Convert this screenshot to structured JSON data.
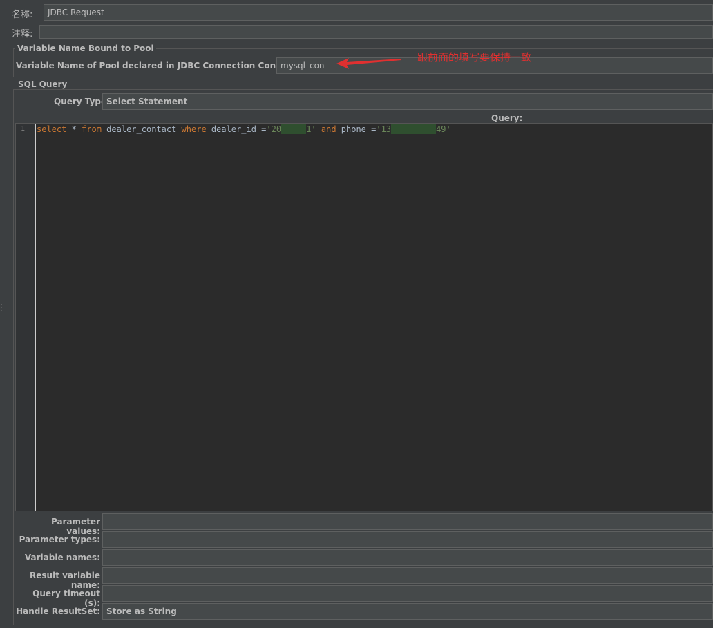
{
  "name_field": {
    "label": "名称:",
    "value": "JDBC Request"
  },
  "comment_field": {
    "label": "注释:",
    "value": ""
  },
  "pool_group": {
    "title": "Variable Name Bound to Pool",
    "pool_label": "Variable Name of Pool declared in JDBC Connection Configuration:",
    "pool_value": "mysql_con"
  },
  "annotation": {
    "text": "跟前面的填写要保持一致",
    "color": "#e03030"
  },
  "sql_group": {
    "title": "SQL Query",
    "query_type_label": "Query Type:",
    "query_type_value": "Select Statement",
    "query_label": "Query:",
    "line_number": "1",
    "code": {
      "t1": "select",
      "t2": " * ",
      "t3": "from",
      "t4": " dealer_contact ",
      "t5": "where",
      "t6": " dealer_id =",
      "t7": "'20",
      "t8": "     ",
      "t9": "1'",
      "t10": " ",
      "t11": "and",
      "t12": " phone =",
      "t13": "'13",
      "t14": "         ",
      "t15": "49'"
    }
  },
  "params": [
    {
      "label": "Parameter values:",
      "value": ""
    },
    {
      "label": "Parameter types:",
      "value": ""
    },
    {
      "label": "Variable names:",
      "value": ""
    },
    {
      "label": "Result variable name:",
      "value": ""
    },
    {
      "label": "Query timeout (s):",
      "value": ""
    },
    {
      "label": "Handle ResultSet:",
      "value": "Store as String"
    }
  ],
  "colors": {
    "background": "#3c3f41",
    "editor": "#2b2b2b",
    "keyword": "#cc7832",
    "string": "#6a8759"
  }
}
